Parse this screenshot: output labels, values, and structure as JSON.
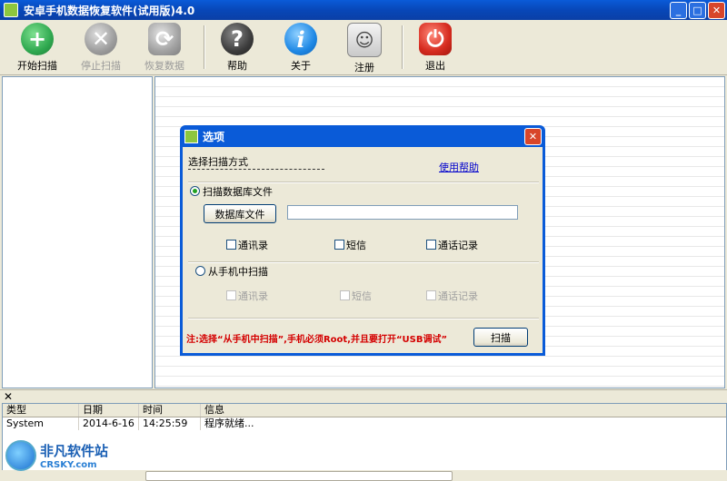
{
  "window": {
    "title": "安卓手机数据恢复软件(试用版)4.0",
    "min": "_",
    "max": "□",
    "close": "✕"
  },
  "toolbar": {
    "start_scan": "开始扫描",
    "stop_scan": "停止扫描",
    "restore_data": "恢复数据",
    "help": "帮助",
    "about": "关于",
    "register": "注册",
    "exit": "退出"
  },
  "dialog": {
    "title": "选项",
    "close": "✕",
    "scan_method_label": "选择扫描方式",
    "help_link": "使用帮助",
    "option_db": "扫描数据库文件",
    "db_file_button": "数据库文件",
    "db_path_value": "",
    "db_checks": {
      "contacts": "通讯录",
      "sms": "短信",
      "call_log": "通话记录"
    },
    "option_phone": "从手机中扫描",
    "phone_checks": {
      "contacts": "通讯录",
      "sms": "短信",
      "call_log": "通话记录"
    },
    "note": "注:选择“从手机中扫描”,手机必须Root,并且要打开“USB调试”",
    "scan_button": "扫描"
  },
  "log": {
    "close": "✕",
    "headers": [
      "类型",
      "日期",
      "时间",
      "信息"
    ],
    "rows": [
      [
        "System",
        "2014-6-16",
        "14:25:59",
        "程序就绪..."
      ]
    ]
  },
  "watermark": {
    "cn": "非凡软件站",
    "en": "CRSKY.com"
  },
  "colors": {
    "titlebar": "#0a5bd8",
    "start": "#2fa84f",
    "exit": "#d62b1f",
    "about": "#1e88e5",
    "note": "#d40000"
  }
}
